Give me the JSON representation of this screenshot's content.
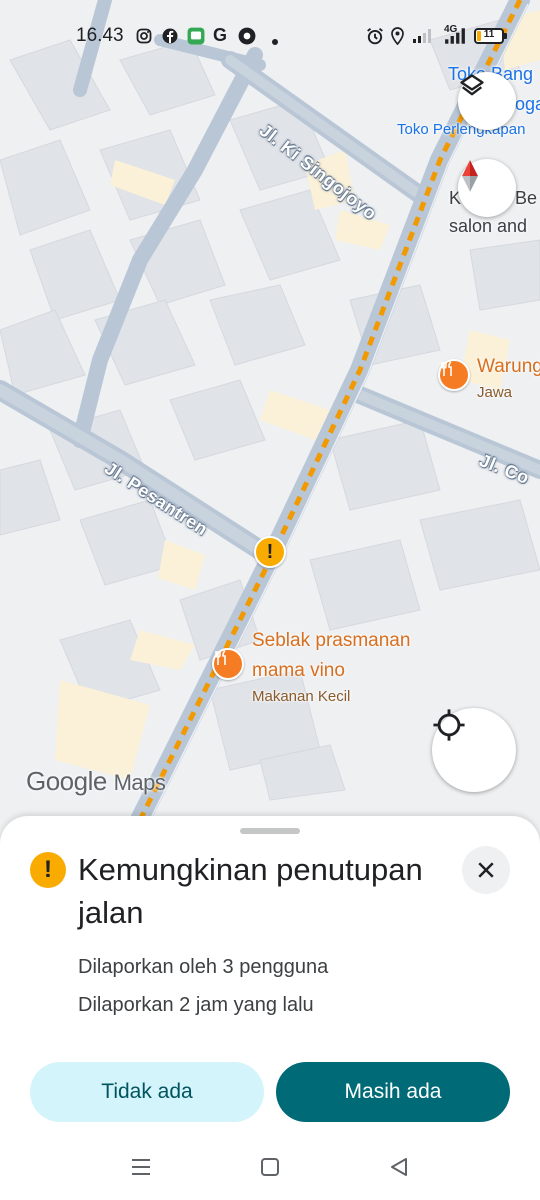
{
  "status_bar": {
    "time": "16.43",
    "network": "4G",
    "battery": "11",
    "icons": [
      "instagram-icon",
      "facebook-icon",
      "messages-icon",
      "g-icon",
      "app-icon",
      "dot",
      "alarm-icon",
      "location-icon",
      "signal-icon",
      "signal-4g-icon",
      "battery-icon"
    ]
  },
  "map": {
    "streets": {
      "ki_singojoyo": "Jl. Ki Singojoyo",
      "pesantren": "Jl. Pesantren",
      "co": "Jl. Co"
    },
    "places": {
      "toko_bang": "Toko Bang",
      "toko_bang_line2": "oga",
      "toko_perlengkapan": "Toko Perlengkapan",
      "salon_line1": "Be",
      "salon_line2": "salon and",
      "salon_prefix": "K"
    },
    "pois": [
      {
        "name": "Warung",
        "sub": "Jawa"
      },
      {
        "name_line1": "Seblak prasmanan",
        "name_line2": "mama vino",
        "sub": "Makanan Kecil"
      }
    ],
    "logo": {
      "google": "Google",
      "maps": "Maps"
    },
    "colors": {
      "road": "#b8c6d6",
      "building": "#e1e4e8",
      "route": "#f29900",
      "poi": "#f57c23"
    }
  },
  "sheet": {
    "title": "Kemungkinan penutupan jalan",
    "reported_by": "Dilaporkan oleh 3 pengguna",
    "reported_time": "Dilaporkan 2 jam yang lalu",
    "btn_no": "Tidak ada",
    "btn_yes": "Masih ada",
    "colors": {
      "no_bg": "#d3f4fb",
      "yes_bg": "#006b77",
      "warning": "#f9ab00"
    }
  }
}
